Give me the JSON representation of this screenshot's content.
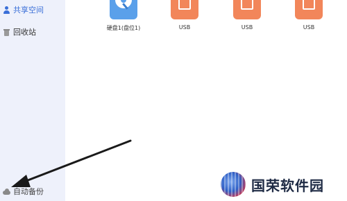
{
  "sidebar": {
    "items": [
      {
        "label": "共享空间",
        "icon": "user-icon",
        "active": true
      },
      {
        "label": "回收站",
        "icon": "trash-icon",
        "active": false
      },
      {
        "label": "自动备份",
        "icon": "cloud-icon",
        "active": false
      }
    ]
  },
  "drives": [
    {
      "label": "硬盘1(盘位1)",
      "icon": "hard-disk-icon"
    },
    {
      "label": "USB",
      "icon": "usb-icon"
    },
    {
      "label": "USB",
      "icon": "usb-icon"
    },
    {
      "label": "USB",
      "icon": "usb-icon"
    }
  ],
  "watermark": {
    "text": "国荣软件园"
  },
  "colors": {
    "sidebar_bg": "#eef1fb",
    "accent": "#3a6fd8",
    "hdd": "#5aa0ea",
    "usb": "#f2865a"
  }
}
